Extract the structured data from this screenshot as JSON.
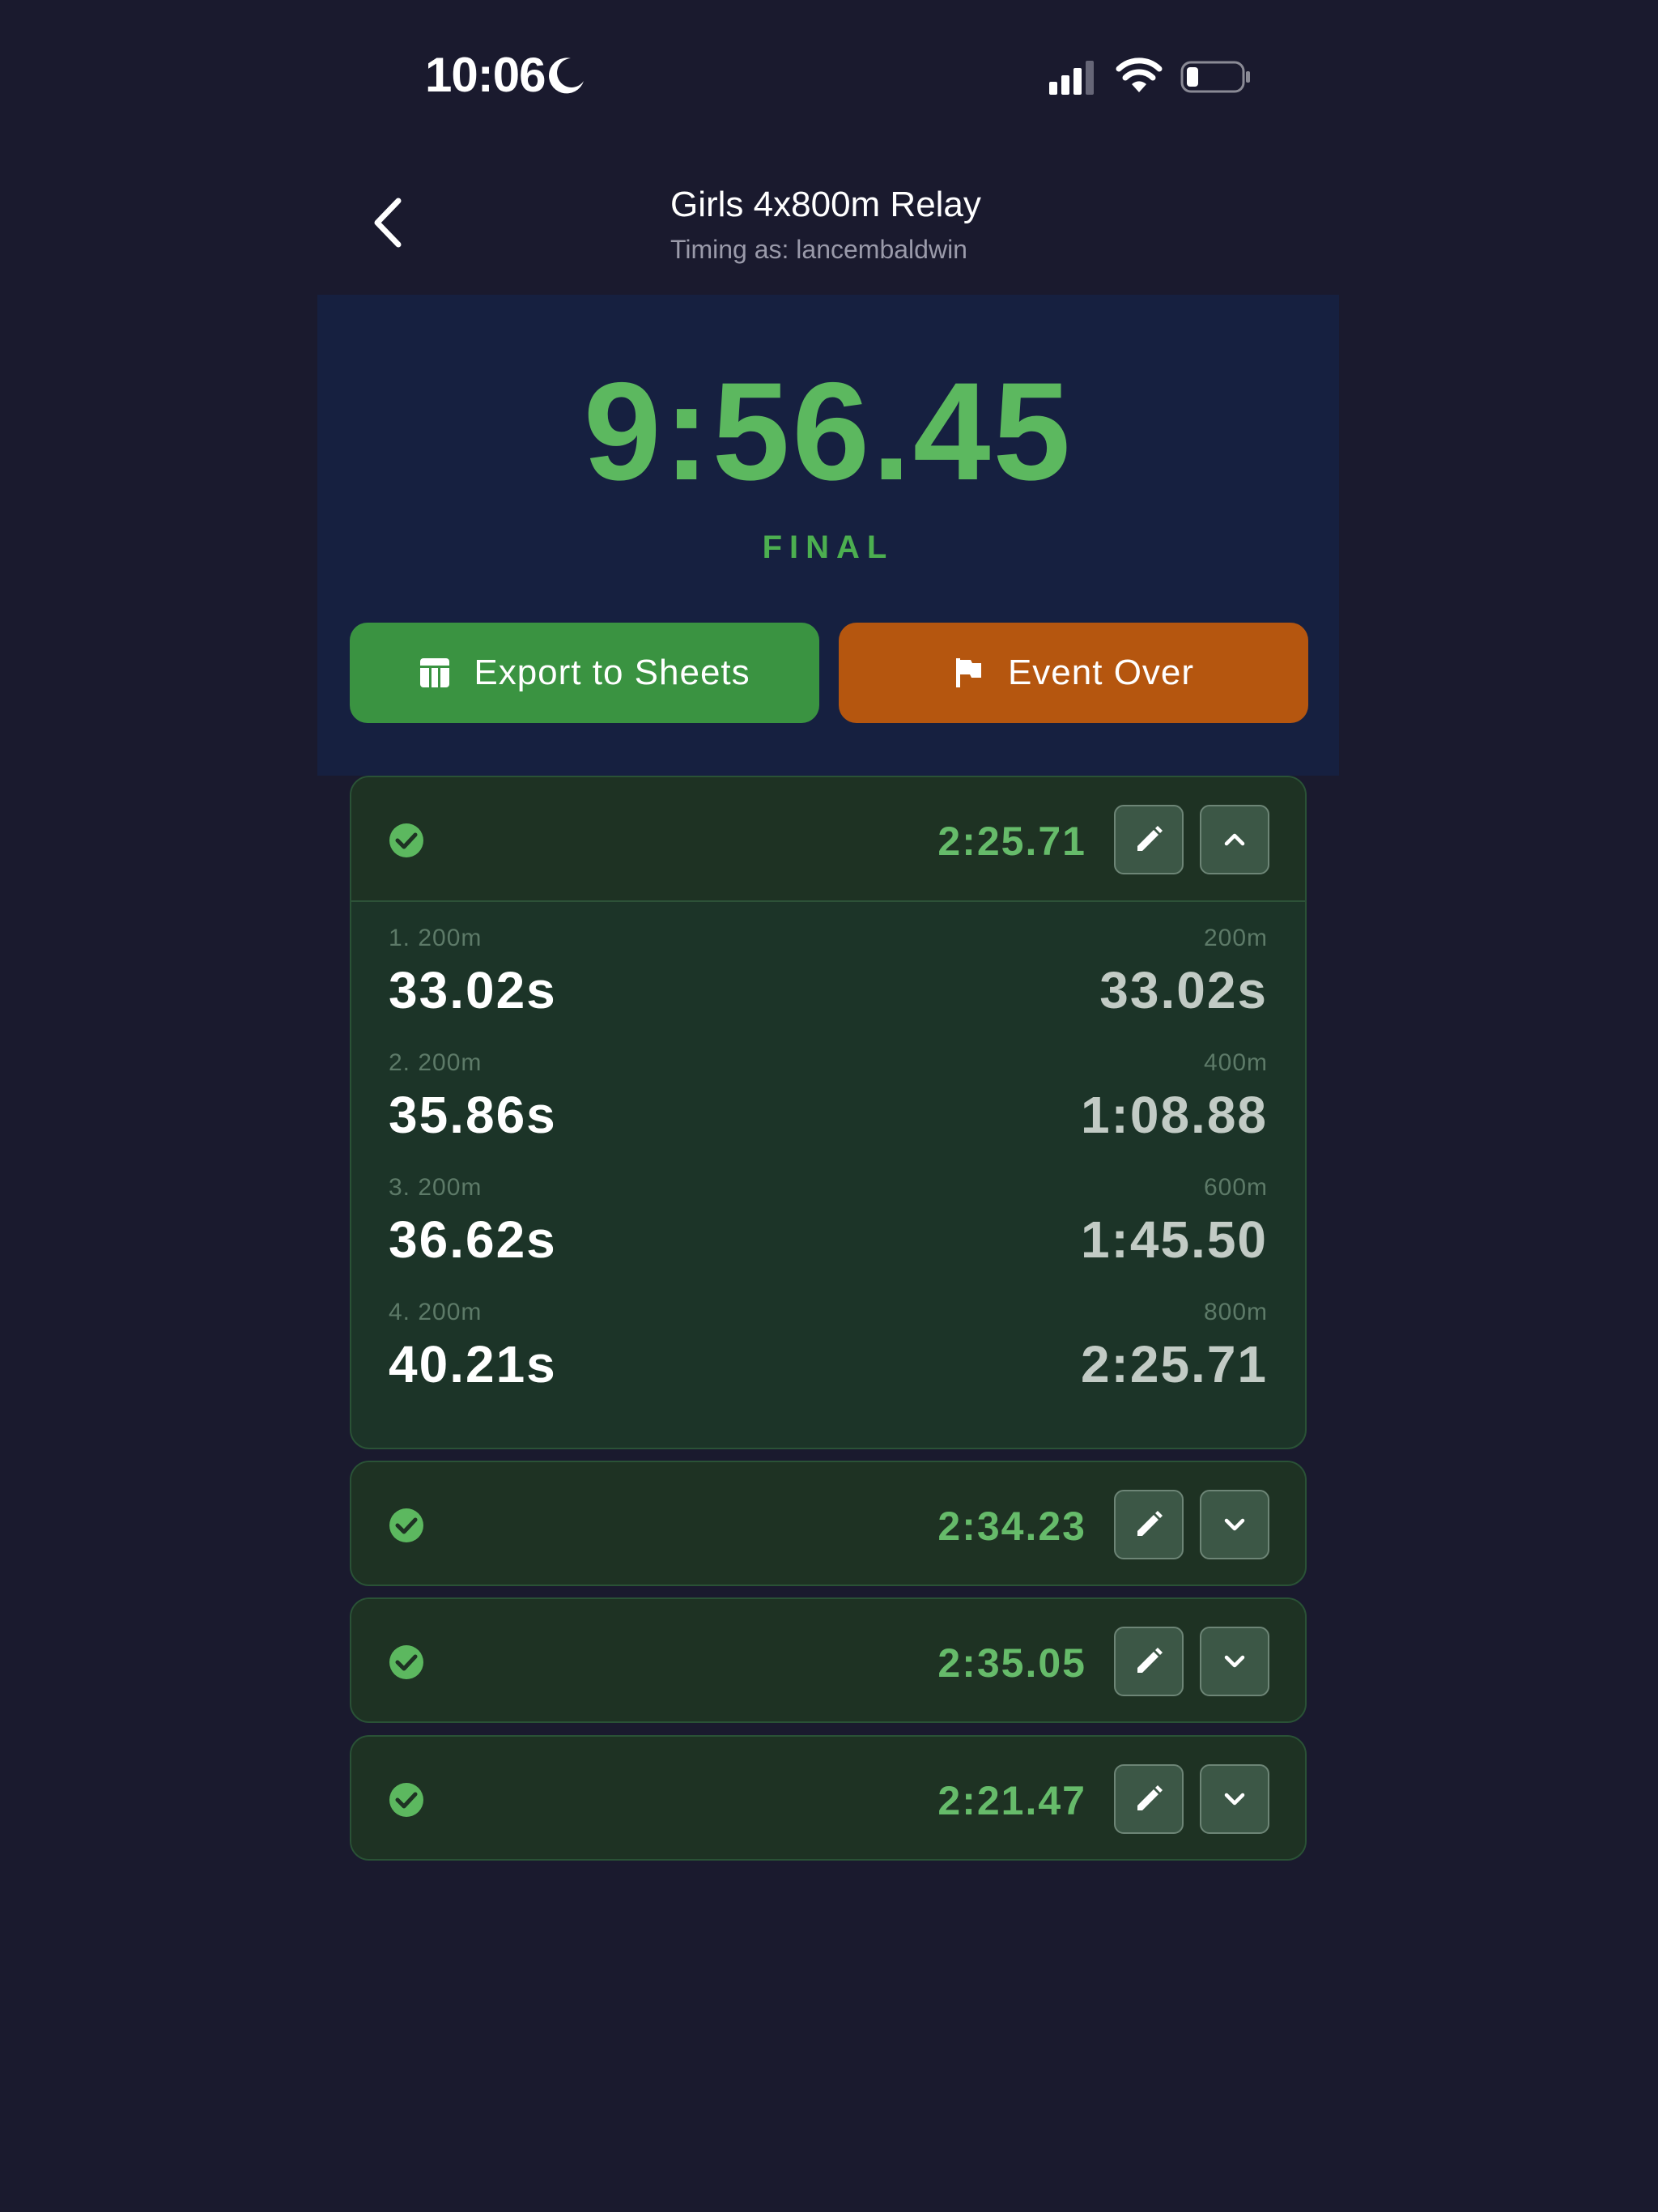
{
  "status_bar": {
    "time": "10:06",
    "icons": [
      "moon-icon",
      "cellular-signal-icon",
      "wifi-icon",
      "battery-icon"
    ]
  },
  "header": {
    "title": "Girls 4x800m Relay",
    "subtitle": "Timing as: lancembaldwin"
  },
  "timer": {
    "total_time": "9:56.45",
    "status": "FINAL",
    "color": "#5cb85f"
  },
  "actions": {
    "export_label": "Export to Sheets",
    "event_over_label": "Event Over",
    "export_color": "#3a9341",
    "event_over_color": "#b5560f"
  },
  "teams": [
    {
      "time": "2:25.71",
      "expanded": true,
      "splits": [
        {
          "label": "1. 200m",
          "split": "33.02s",
          "cum_label": "200m",
          "cum": "33.02s"
        },
        {
          "label": "2. 200m",
          "split": "35.86s",
          "cum_label": "400m",
          "cum": "1:08.88"
        },
        {
          "label": "3. 200m",
          "split": "36.62s",
          "cum_label": "600m",
          "cum": "1:45.50"
        },
        {
          "label": "4. 200m",
          "split": "40.21s",
          "cum_label": "800m",
          "cum": "2:25.71"
        }
      ]
    },
    {
      "time": "2:34.23",
      "expanded": false
    },
    {
      "time": "2:35.05",
      "expanded": false
    },
    {
      "time": "2:21.47",
      "expanded": false
    }
  ]
}
